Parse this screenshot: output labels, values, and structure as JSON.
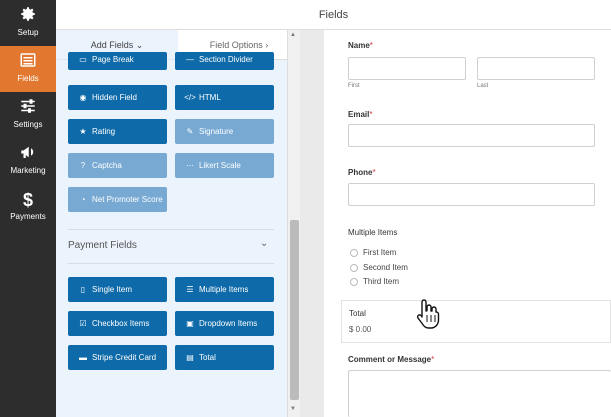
{
  "nav": {
    "items": [
      {
        "label": "Setup",
        "icon": "gear-icon"
      },
      {
        "label": "Fields",
        "icon": "list-icon",
        "active": true
      },
      {
        "label": "Settings",
        "icon": "sliders-icon"
      },
      {
        "label": "Marketing",
        "icon": "megaphone-icon"
      },
      {
        "label": "Payments",
        "icon": "dollar-icon"
      }
    ]
  },
  "header": {
    "title": "Fields"
  },
  "panel": {
    "tabs": {
      "add": "Add Fields",
      "options": "Field Options"
    },
    "fancy_fields": [
      {
        "label": "Page Break",
        "icon": "page-break-icon"
      },
      {
        "label": "Section Divider",
        "icon": "divider-icon"
      },
      {
        "label": "Hidden Field",
        "icon": "eye-slash-icon"
      },
      {
        "label": "HTML",
        "icon": "code-icon"
      },
      {
        "label": "Rating",
        "icon": "star-icon"
      },
      {
        "label": "Signature",
        "icon": "pen-icon"
      },
      {
        "label": "Captcha",
        "icon": "question-icon"
      },
      {
        "label": "Likert Scale",
        "icon": "likert-icon"
      },
      {
        "label": "Net Promoter Score",
        "icon": "gauge-icon"
      }
    ],
    "payment_section": {
      "title": "Payment Fields",
      "fields": [
        {
          "label": "Single Item",
          "icon": "file-icon"
        },
        {
          "label": "Multiple Items",
          "icon": "list-icon"
        },
        {
          "label": "Checkbox Items",
          "icon": "checkbox-icon"
        },
        {
          "label": "Dropdown Items",
          "icon": "dropdown-icon"
        },
        {
          "label": "Stripe Credit Card",
          "icon": "credit-card-icon"
        },
        {
          "label": "Total",
          "icon": "money-icon"
        }
      ]
    }
  },
  "preview": {
    "name": {
      "label": "Name",
      "required": "*",
      "first": "First",
      "last": "Last"
    },
    "email": {
      "label": "Email",
      "required": "*"
    },
    "phone": {
      "label": "Phone",
      "required": "*"
    },
    "multiple_items": {
      "label": "Multiple Items",
      "options": [
        "First Item",
        "Second Item",
        "Third Item"
      ]
    },
    "total": {
      "label": "Total",
      "value": "$ 0.00"
    },
    "comment": {
      "label": "Comment or Message",
      "required": "*"
    }
  },
  "colors": {
    "accent": "#e27730",
    "button_dark": "#0e6aa8",
    "button_light": "#77a9d3",
    "sidebar": "#2d2d2d"
  }
}
